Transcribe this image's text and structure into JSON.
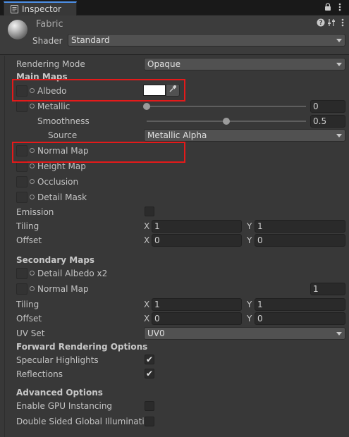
{
  "window": {
    "tab_title": "Inspector"
  },
  "header": {
    "material_name": "Fabric",
    "shader_label": "Shader",
    "shader_value": "Standard"
  },
  "rendering_mode": {
    "label": "Rendering Mode",
    "value": "Opaque"
  },
  "main_maps": {
    "title": "Main Maps",
    "albedo": {
      "label": "Albedo",
      "color": "#ffffff"
    },
    "metallic": {
      "label": "Metallic",
      "value": "0",
      "fraction": 0.0
    },
    "smoothness": {
      "label": "Smoothness",
      "value": "0.5",
      "fraction": 0.5
    },
    "source": {
      "label": "Source",
      "value": "Metallic Alpha"
    },
    "normal_map": {
      "label": "Normal Map"
    },
    "height_map": {
      "label": "Height Map"
    },
    "occlusion": {
      "label": "Occlusion"
    },
    "detail_mask": {
      "label": "Detail Mask"
    },
    "emission": {
      "label": "Emission",
      "checked": false
    },
    "tiling": {
      "label": "Tiling",
      "x": "1",
      "y": "1"
    },
    "offset": {
      "label": "Offset",
      "x": "0",
      "y": "0"
    }
  },
  "secondary_maps": {
    "title": "Secondary Maps",
    "detail_albedo": {
      "label": "Detail Albedo x2"
    },
    "normal_map": {
      "label": "Normal Map",
      "value": "1"
    },
    "tiling": {
      "label": "Tiling",
      "x": "1",
      "y": "1"
    },
    "offset": {
      "label": "Offset",
      "x": "0",
      "y": "0"
    },
    "uv_set": {
      "label": "UV Set",
      "value": "UV0"
    }
  },
  "forward_rendering": {
    "title": "Forward Rendering Options",
    "specular_highlights": {
      "label": "Specular Highlights",
      "checked": true
    },
    "reflections": {
      "label": "Reflections",
      "checked": true
    }
  },
  "advanced": {
    "title": "Advanced Options",
    "gpu_instancing": {
      "label": "Enable GPU Instancing",
      "checked": false
    },
    "double_sided_gi": {
      "label": "Double Sided Global Illumination",
      "checked": false
    }
  },
  "axis_labels": {
    "x": "X",
    "y": "Y"
  },
  "icons": {
    "tab": "inspector-icon",
    "lock": "lock-icon",
    "menu": "kebab-menu-icon",
    "help": "help-icon",
    "preset": "preset-icon",
    "settings": "kebab-menu-icon",
    "picker": "eyedropper-icon"
  },
  "colors": {
    "accent": "#4d90e8",
    "highlight": "#e41a1a",
    "background": "#383838"
  }
}
